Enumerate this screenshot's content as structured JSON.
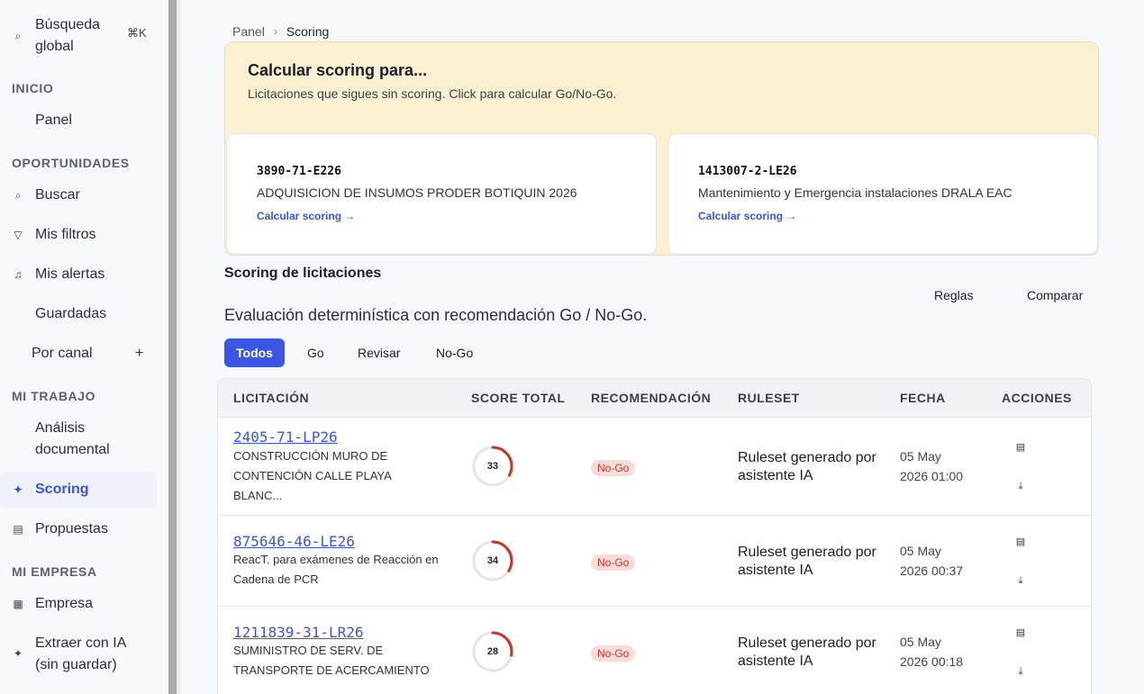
{
  "sidebar": {
    "search": {
      "label": "Búsqueda global",
      "line1": "Búsqueda",
      "line2": "global",
      "shortcut": "⌘K"
    },
    "sections": {
      "inicio": "INICIO",
      "oportunidades": "OPORTUNIDADES",
      "mi_trabajo": "MI TRABAJO",
      "mi_empresa": "MI EMPRESA"
    },
    "items": {
      "panel": "Panel",
      "buscar": "Buscar",
      "mis_filtros": "Mis filtros",
      "mis_alertas": "Mis alertas",
      "guardadas": "Guardadas",
      "por_canal": "Por canal",
      "analisis_1": "Análisis",
      "analisis_2": "documental",
      "scoring": "Scoring",
      "propuestas": "Propuestas",
      "empresa": "Empresa",
      "extraer_1": "Extraer con IA",
      "extraer_2": "(sin guardar)"
    },
    "icons": {
      "search": "search-icon",
      "filter": "filter-icon",
      "bell": "bell-icon",
      "scoring": "sparkles-icon",
      "doc": "document-icon",
      "building": "building-icon",
      "ai": "sparkles-icon"
    }
  },
  "breadcrumb": {
    "root": "Panel",
    "current": "Scoring"
  },
  "banner": {
    "title": "Calcular scoring para...",
    "subtitle": "Licitaciones que sigues sin scoring. Click para calcular Go/No-Go.",
    "cards": [
      {
        "code": "3890-71-E226",
        "title": "ADQUISICION DE INSUMOS PRODER BOTIQUIN 2026",
        "link": "Calcular scoring →"
      },
      {
        "code": "1413007-2-LE26",
        "title": "Mantenimiento y Emergencia instalaciones DRALA EAC",
        "link": "Calcular scoring →"
      }
    ]
  },
  "scoring": {
    "heading": "Scoring de licitaciones",
    "description": "Evaluación determinística con recomendación Go / No-Go.",
    "reglas": "Reglas",
    "comparar": "Comparar",
    "filters": [
      "Todos",
      "Go",
      "Revisar",
      "No-Go"
    ]
  },
  "table": {
    "headers": [
      "LICITACIÓN",
      "SCORE TOTAL",
      "RECOMENDACIÓN",
      "RULESET",
      "FECHA",
      "ACCIONES"
    ],
    "rows": [
      {
        "code": "2405-71-LP26",
        "name": "CONSTRUCCIÓN MURO DE CONTENCIÓN CALLE PLAYA BLANC...",
        "score": "33",
        "score_fraction": 0.33,
        "recommendation": "No-Go",
        "ruleset": "Ruleset generado por asistente IA",
        "date": "05 May",
        "time": "2026 01:00"
      },
      {
        "code": "875646-46-LE26",
        "name": "ReacT. para exámenes de Reacción en Cadena de PCR",
        "score": "34",
        "score_fraction": 0.34,
        "recommendation": "No-Go",
        "ruleset": "Ruleset generado por asistente IA",
        "date": "05 May",
        "time": "2026 00:37"
      },
      {
        "code": "1211839-31-LR26",
        "name": "SUMINISTRO DE SERV. DE TRANSPORTE DE ACERCAMIENTO",
        "score": "28",
        "score_fraction": 0.28,
        "recommendation": "No-Go",
        "ruleset": "Ruleset generado por asistente IA",
        "date": "05 May",
        "time": "2026 00:18"
      }
    ]
  },
  "colors": {
    "accent": "#3b55e6",
    "banner_bg": "#fbf0cf",
    "nogo_bg": "#fbdcd8",
    "nogo_text": "#c0392b",
    "gauge_arc": "#c0392b"
  }
}
